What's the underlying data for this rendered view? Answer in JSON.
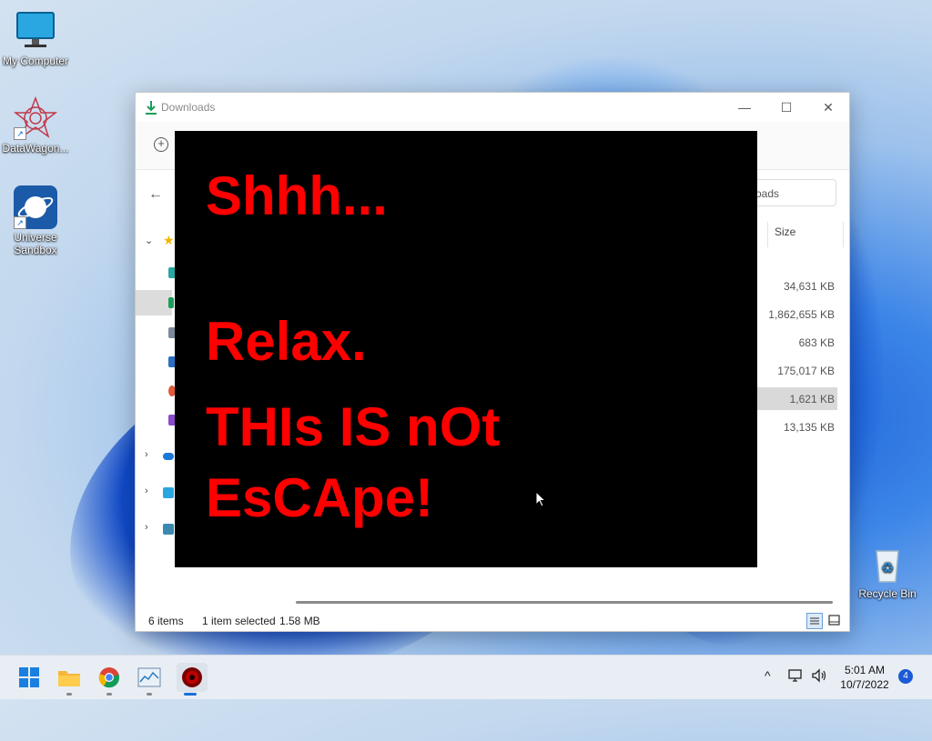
{
  "desktop": {
    "icons": [
      {
        "label": "My Computer",
        "icon": "monitor-icon"
      },
      {
        "label": "DataWagon...",
        "icon": "datawagon-icon"
      },
      {
        "label": "Universe Sandbox",
        "icon": "universe-sandbox-icon"
      },
      {
        "label": "Recycle Bin",
        "icon": "recycle-bin-icon"
      }
    ]
  },
  "window": {
    "title": "Downloads",
    "search_placeholder": "oads",
    "column_size_header": "Size",
    "file_sizes": [
      "34,631 KB",
      "1,862,655 KB",
      "683 KB",
      "175,017 KB",
      "1,621 KB",
      "13,135 KB"
    ],
    "selected_index": 4,
    "status": {
      "items": "6 items",
      "selection": "1 item selected",
      "selection_size": "1.58 MB"
    }
  },
  "overlay": {
    "line1": "Shhh...",
    "line2": "Relax.",
    "line3": "THIs IS nOt",
    "line4": "EsCApe!",
    "text_color": "#ff0000",
    "background": "#000000"
  },
  "taskbar": {
    "apps": [
      "start-icon",
      "file-explorer-icon",
      "chrome-icon",
      "task-manager-icon",
      "malware-app-icon"
    ],
    "time": "5:01 AM",
    "date": "10/7/2022",
    "notification_count": "4"
  }
}
